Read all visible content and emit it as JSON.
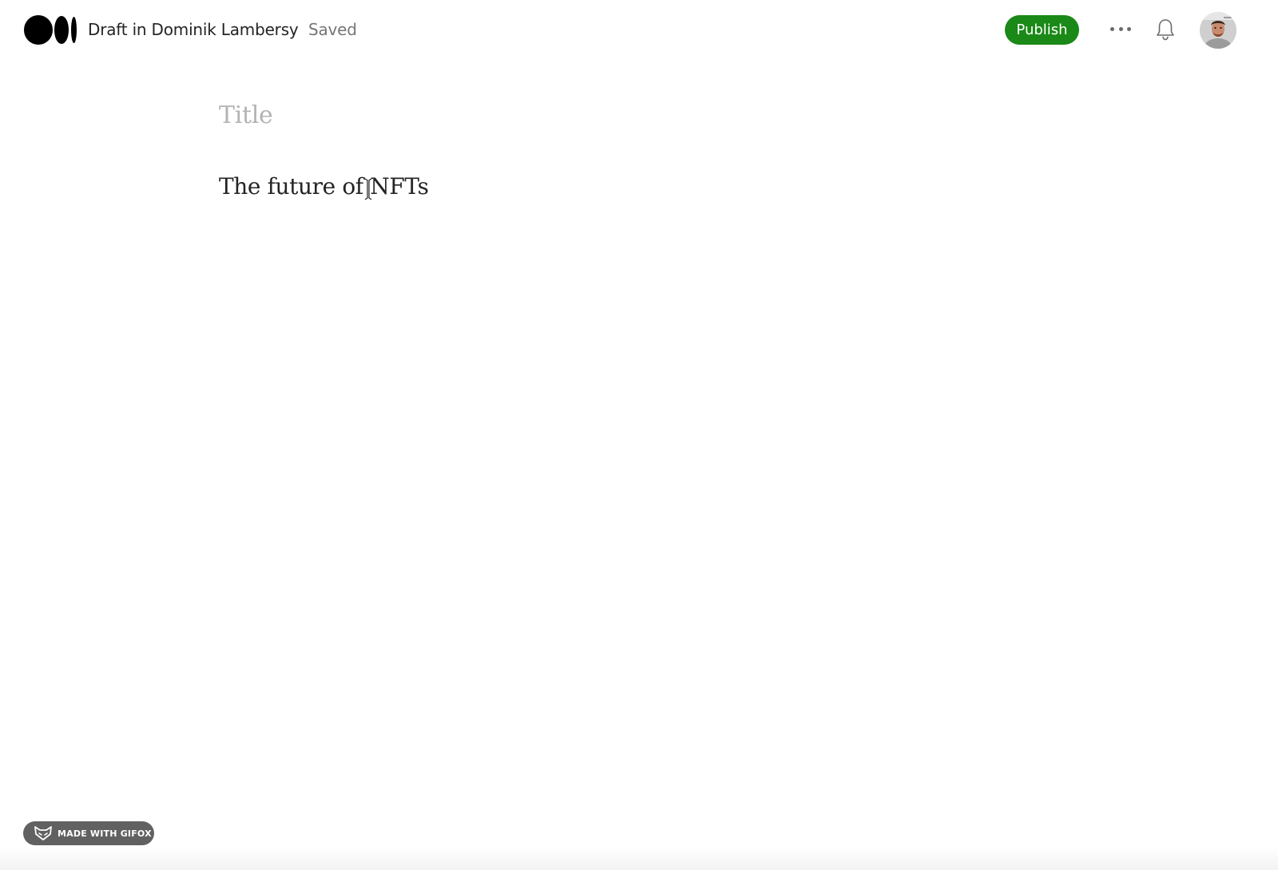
{
  "header": {
    "logo_icon": "medium-logo-icon",
    "draft_label": "Draft in Dominik Lambersy",
    "status": "Saved",
    "publish_label": "Publish",
    "more_icon": "more-horizontal-icon",
    "notification_icon": "bell-icon",
    "avatar": "user-avatar"
  },
  "editor": {
    "title_placeholder": "Title",
    "body_text": "The future of NFTs"
  },
  "badge": {
    "icon": "fox-icon",
    "text": "MADE WITH GIFOX"
  },
  "colors": {
    "publish": "#1a8917",
    "text": "#242424",
    "muted": "#757575",
    "placeholder": "#b3b3b3"
  }
}
